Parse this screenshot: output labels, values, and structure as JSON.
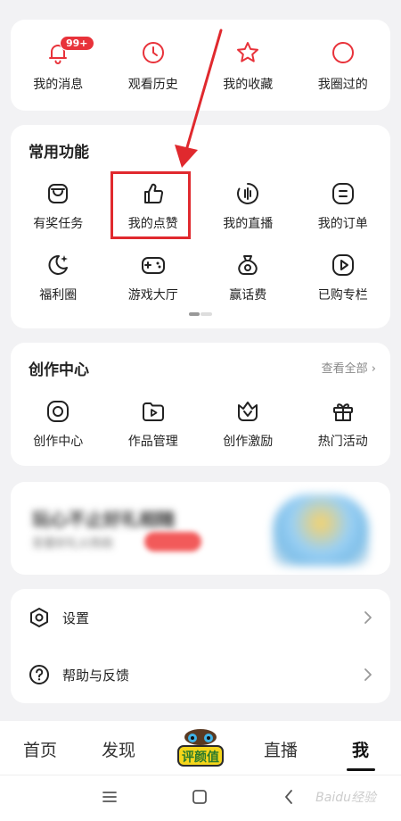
{
  "quick": {
    "items": [
      {
        "label": "我的消息",
        "icon": "bell-icon",
        "badge": "99+"
      },
      {
        "label": "观看历史",
        "icon": "clock-icon"
      },
      {
        "label": "我的收藏",
        "icon": "star-icon"
      },
      {
        "label": "我圈过的",
        "icon": "circle-icon"
      }
    ]
  },
  "common": {
    "title": "常用功能",
    "items": [
      {
        "label": "有奖任务",
        "icon": "reward-task-icon"
      },
      {
        "label": "我的点赞",
        "icon": "thumbs-up-icon"
      },
      {
        "label": "我的直播",
        "icon": "live-icon"
      },
      {
        "label": "我的订单",
        "icon": "order-icon"
      },
      {
        "label": "福利圈",
        "icon": "moon-star-icon"
      },
      {
        "label": "游戏大厅",
        "icon": "gamepad-icon"
      },
      {
        "label": "赢话费",
        "icon": "money-bag-icon"
      },
      {
        "label": "已购专栏",
        "icon": "play-square-icon"
      }
    ]
  },
  "create": {
    "title": "创作中心",
    "more": "查看全部",
    "items": [
      {
        "label": "创作中心",
        "icon": "camera-icon"
      },
      {
        "label": "作品管理",
        "icon": "folder-play-icon"
      },
      {
        "label": "创作激励",
        "icon": "crown-icon"
      },
      {
        "label": "热门活动",
        "icon": "gift-icon"
      }
    ]
  },
  "banner": {
    "title": "玩心不止好礼相随",
    "subtitle": "至爱好礼火热抢",
    "image": "banner-illustration"
  },
  "settings": {
    "items": [
      {
        "label": "设置",
        "icon": "settings-hex-icon"
      },
      {
        "label": "帮助与反馈",
        "icon": "help-icon"
      }
    ]
  },
  "bottomnav": {
    "items": [
      "首页",
      "发现",
      "直播",
      "我"
    ],
    "active": "我",
    "center_logo": "评颜值"
  },
  "watermark": "Baidu经验",
  "colors": {
    "accent": "#e8323a",
    "highlight": "#e0292e",
    "background": "#f2f2f4"
  }
}
